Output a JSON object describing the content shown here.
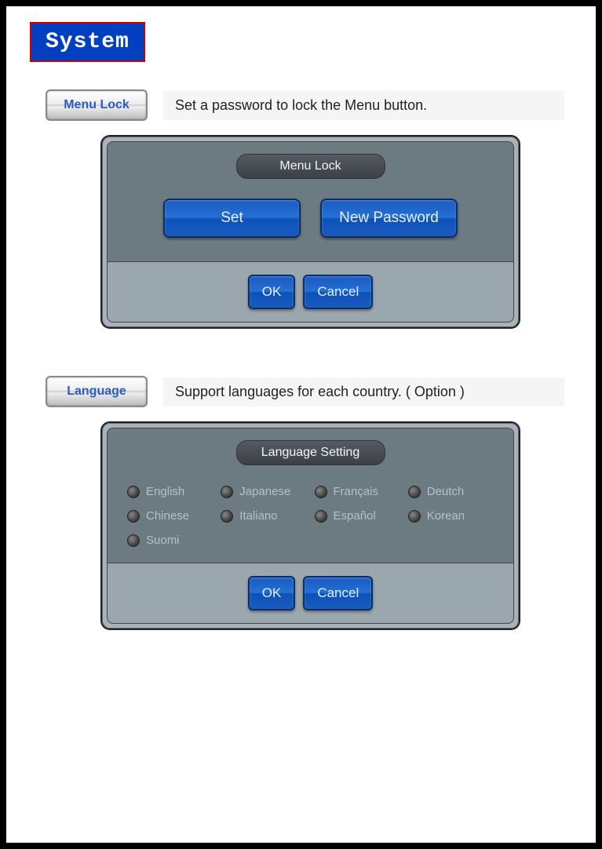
{
  "title": "System",
  "sections": {
    "menuLock": {
      "label": "Menu Lock",
      "description": "Set a password to lock the Menu button.",
      "dialog": {
        "title": "Menu Lock",
        "buttons": {
          "set": "Set",
          "newPassword": "New Password"
        },
        "footer": {
          "ok": "OK",
          "cancel": "Cancel"
        }
      }
    },
    "language": {
      "label": "Language",
      "description": "Support languages for each country. ( Option )",
      "dialog": {
        "title": "Language Setting",
        "options": [
          "English",
          "Japanese",
          "Français",
          "Deutch",
          "Chinese",
          "Italiano",
          "Español",
          "Korean",
          "Suomi"
        ],
        "footer": {
          "ok": "OK",
          "cancel": "Cancel"
        }
      }
    }
  }
}
